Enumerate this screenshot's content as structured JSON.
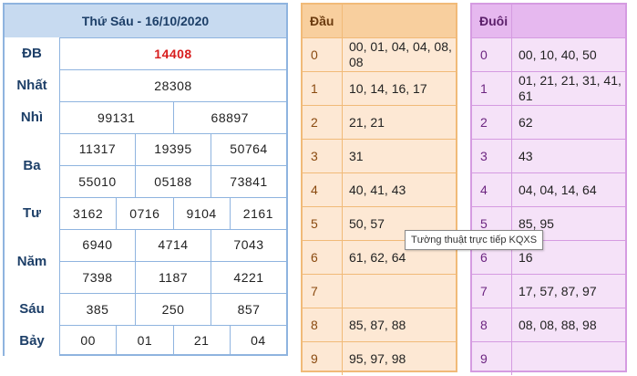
{
  "results": {
    "title": "Thứ Sáu - 16/10/2020",
    "prizes": [
      {
        "label": "ĐB",
        "rows": [
          [
            "14408"
          ]
        ],
        "special": true
      },
      {
        "label": "Nhất",
        "rows": [
          [
            "28308"
          ]
        ]
      },
      {
        "label": "Nhì",
        "rows": [
          [
            "99131",
            "68897"
          ]
        ]
      },
      {
        "label": "Ba",
        "rows": [
          [
            "11317",
            "19395",
            "50764"
          ],
          [
            "55010",
            "05188",
            "73841"
          ]
        ]
      },
      {
        "label": "Tư",
        "rows": [
          [
            "3162",
            "0716",
            "9104",
            "2161"
          ]
        ]
      },
      {
        "label": "Năm",
        "rows": [
          [
            "6940",
            "4714",
            "7043"
          ],
          [
            "7398",
            "1187",
            "4221"
          ]
        ]
      },
      {
        "label": "Sáu",
        "rows": [
          [
            "385",
            "250",
            "857"
          ]
        ]
      },
      {
        "label": "Bảy",
        "rows": [
          [
            "00",
            "01",
            "21",
            "04"
          ]
        ]
      }
    ]
  },
  "dau": {
    "header": "Đầu",
    "rows": [
      {
        "key": "0",
        "value": "00, 01, 04, 04, 08, 08"
      },
      {
        "key": "1",
        "value": "10, 14, 16, 17"
      },
      {
        "key": "2",
        "value": "21, 21"
      },
      {
        "key": "3",
        "value": "31"
      },
      {
        "key": "4",
        "value": "40, 41, 43"
      },
      {
        "key": "5",
        "value": "50, 57"
      },
      {
        "key": "6",
        "value": "61, 62, 64"
      },
      {
        "key": "7",
        "value": ""
      },
      {
        "key": "8",
        "value": "85, 87, 88"
      },
      {
        "key": "9",
        "value": "95, 97, 98"
      }
    ]
  },
  "duoi": {
    "header": "Đuôi",
    "rows": [
      {
        "key": "0",
        "value": "00, 10, 40, 50"
      },
      {
        "key": "1",
        "value": "01, 21, 21, 31, 41, 61"
      },
      {
        "key": "2",
        "value": "62"
      },
      {
        "key": "3",
        "value": "43"
      },
      {
        "key": "4",
        "value": "04, 04, 14, 64"
      },
      {
        "key": "5",
        "value": "85, 95"
      },
      {
        "key": "6",
        "value": "16"
      },
      {
        "key": "7",
        "value": "17, 57, 87, 97"
      },
      {
        "key": "8",
        "value": "08, 08, 88, 98"
      },
      {
        "key": "9",
        "value": ""
      }
    ]
  },
  "tooltip": "Tường thuật trực tiếp KQXS",
  "colors": {
    "special_number": "#d81e1e",
    "results_header": "#c7daf0",
    "dau_header": "#f8cf9e",
    "duoi_header": "#e6b8ef"
  }
}
